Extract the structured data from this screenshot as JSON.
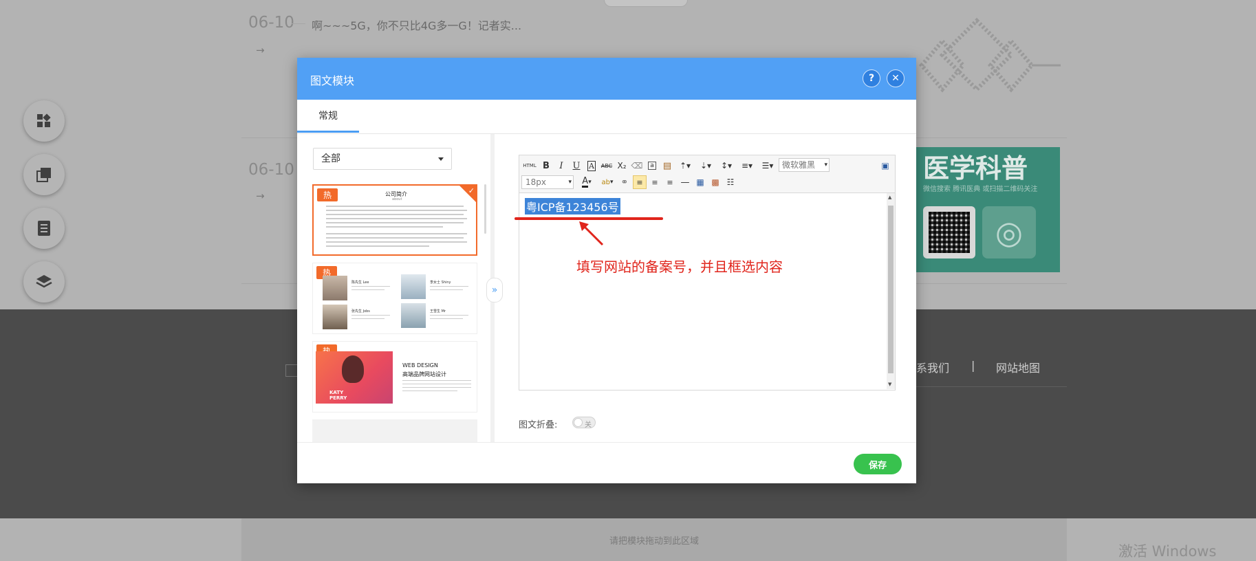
{
  "background": {
    "news": [
      {
        "date": "06-10",
        "title": "啊~~~5G，你不只比4G多一G！记者实...",
        "arrow": "→"
      },
      {
        "date": "06-10",
        "title": "",
        "arrow": "→"
      }
    ],
    "promo": {
      "title": "医学科普",
      "subtitle": "微信搜索 腾讯医典 或扫描二维码关注"
    },
    "footer_links": [
      "系我们",
      "|",
      "网站地图"
    ],
    "drop_zone_text": "请把模块拖动到此区域",
    "windows_watermark": "激活 Windows",
    "side_icons": [
      "modules-icon",
      "copy-icon",
      "page-icon",
      "layers-icon"
    ],
    "keyboard_icon": "keyboard-icon"
  },
  "modal": {
    "title": "图文模块",
    "help_label": "?",
    "close_label": "✕",
    "tab": "常规",
    "filter": {
      "selected": "全部"
    },
    "templates": [
      {
        "badge": "热",
        "heading": "公司简介",
        "subheading": "about"
      },
      {
        "badge": "热",
        "people": [
          "陈先生 Lee",
          "李女士 Shiny",
          "张先生 Jobs",
          "王雪生 Mr"
        ]
      },
      {
        "badge": "热",
        "headline": "WEB DESIGN",
        "subline": "高端品牌网站设计",
        "poster": "KATY PERRY"
      }
    ],
    "collapse_icon": "»",
    "toolbar": {
      "html_label": "HTML",
      "bold": "B",
      "italic": "I",
      "underline": "U",
      "strike": "ABC",
      "subscript": "X₂",
      "font_family": "微软雅黑",
      "font_size": "18px",
      "font_color": "A",
      "highlight": "ab"
    },
    "editor_content": "粤ICP备123456号",
    "annotation": "填写网站的备案号，并且框选内容",
    "fold_label": "图文折叠:",
    "fold_state": "关",
    "save_label": "保存",
    "colors": {
      "header": "#51a0f5",
      "save": "#38c24e",
      "annotation": "#e0251c",
      "hot": "#f26a2a"
    }
  }
}
